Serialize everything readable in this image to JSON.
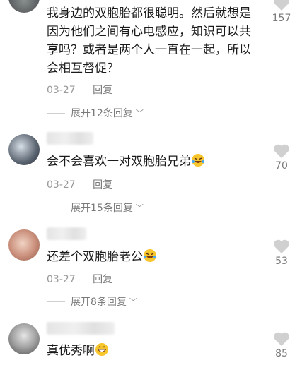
{
  "comments": [
    {
      "text": "我身边的双胞胎都很聪明。然后就想是因为他们之间有心电感应，知识可以共享吗？或者是两个人一直在一起，所以会相互督促？",
      "date": "03-27",
      "reply_label": "回复",
      "expand_label": "展开12条回复",
      "likes": "157"
    },
    {
      "text": "会不会喜欢一对双胞胎兄弟",
      "emoji": "laughing-crying-emoji",
      "date": "03-27",
      "reply_label": "回复",
      "expand_label": "展开15条回复",
      "likes": "70"
    },
    {
      "text": "还差个双胞胎老公",
      "emoji": "laughing-crying-emoji",
      "date": "03-27",
      "reply_label": "回复",
      "expand_label": "展开8条回复",
      "likes": "53"
    },
    {
      "text": "真优秀啊",
      "emoji": "grinning-emoji",
      "likes": "85"
    }
  ],
  "colors": {
    "text": "#1a1a1a",
    "meta": "#9a9a9a",
    "heart": "#d0d0d0"
  }
}
